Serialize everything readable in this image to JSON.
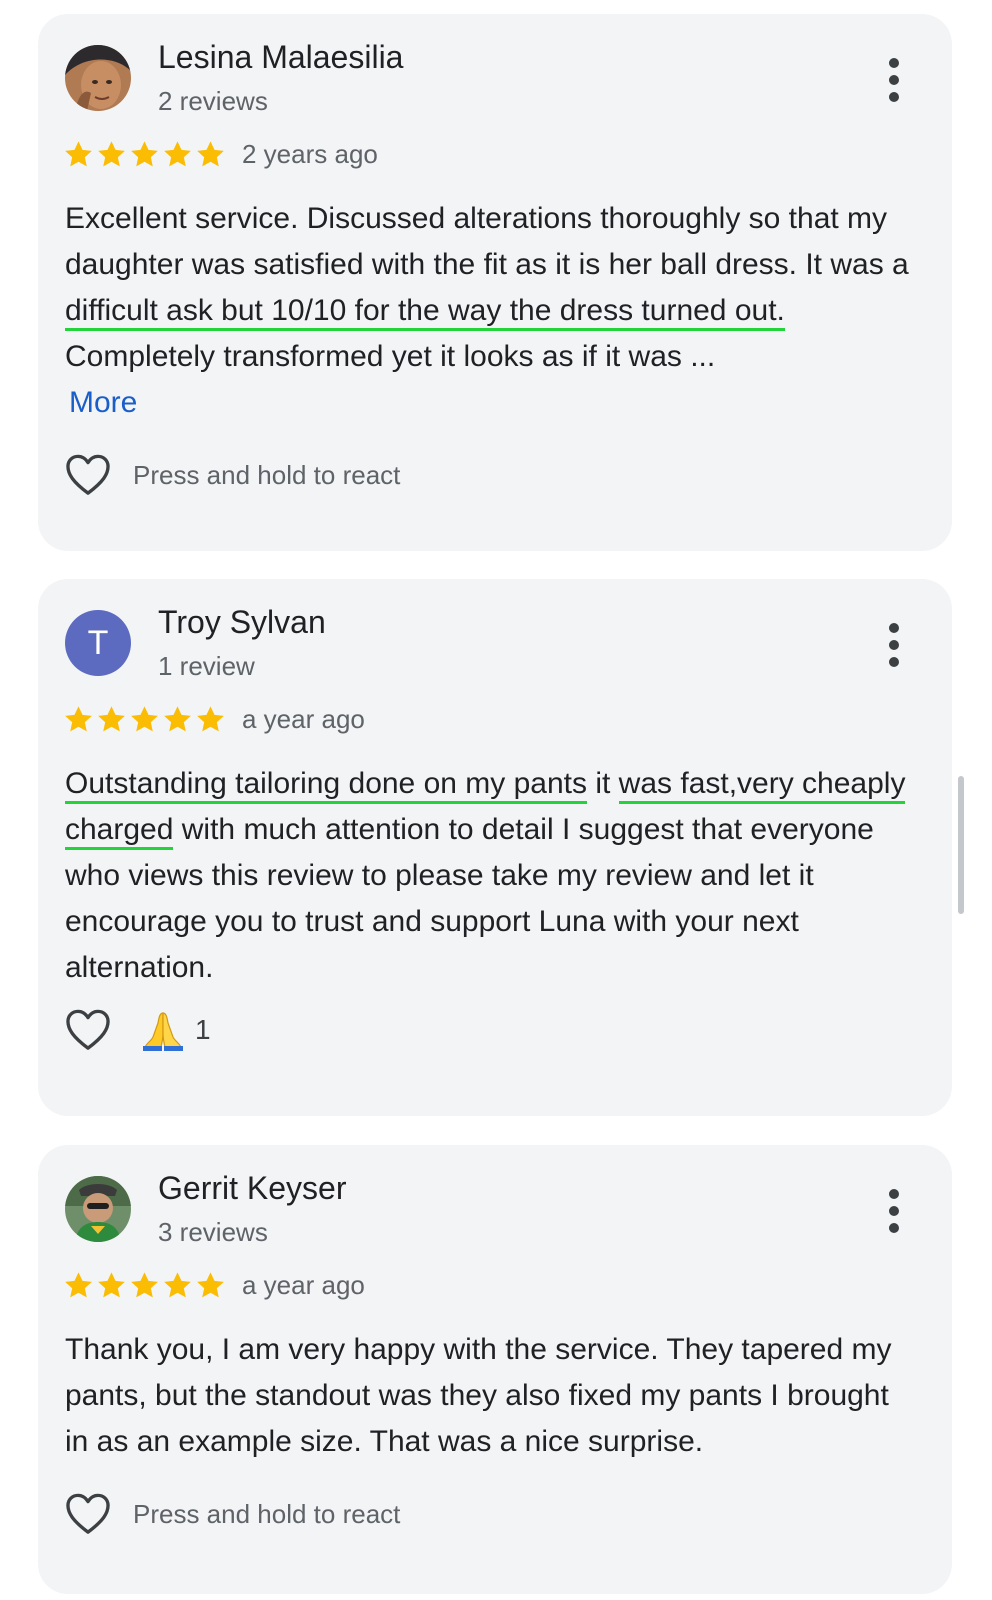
{
  "reviews": [
    {
      "name": "Lesina Malaesilia",
      "review_count": "2 reviews",
      "rating": 5,
      "age": "2 years ago",
      "text": {
        "before": "Excellent service. Discussed alterations thoroughly so that my daughter was satisfied with the fit as it is her ball dress. It was a ",
        "highlight": "difficult ask but 10/10 for the way the dress turned out.",
        "after": " Completely transformed yet it looks as if it was ..."
      },
      "more_label": "More",
      "react_label": "Press and hold to react",
      "avatar_icon": "profile-photo"
    },
    {
      "name": "Troy Sylvan",
      "review_count": "1 review",
      "rating": 5,
      "age": "a year ago",
      "avatar_letter": "T",
      "text": {
        "h1": "Outstanding tailoring done on my pants",
        "mid": " it ",
        "h2": "was fast,very cheaply charged",
        "after": " with much attention to detail I suggest that everyone who views this review to please take my review and let it encourage you to trust and support Luna with your next alternation."
      },
      "reaction_emoji": "folded-hands-icon",
      "reaction_count": "1"
    },
    {
      "name": "Gerrit Keyser",
      "review_count": "3 reviews",
      "rating": 5,
      "age": "a year ago",
      "text": "Thank you, I am very happy with the service. They tapered my pants, but the standout was they also fixed my pants I brought in as an example size. That was a nice surprise.",
      "react_label": "Press and hold to react",
      "avatar_icon": "profile-photo"
    }
  ],
  "colors": {
    "card_bg": "#f2f4f6",
    "star": "#fbbc04",
    "link": "#1a5fc9",
    "highlight_underline": "#22d43a",
    "avatar_letter_bg": "#5c6bc0"
  },
  "icons": {
    "star": "star-icon",
    "heart": "heart-outline-icon",
    "menu": "more-vert-icon"
  }
}
